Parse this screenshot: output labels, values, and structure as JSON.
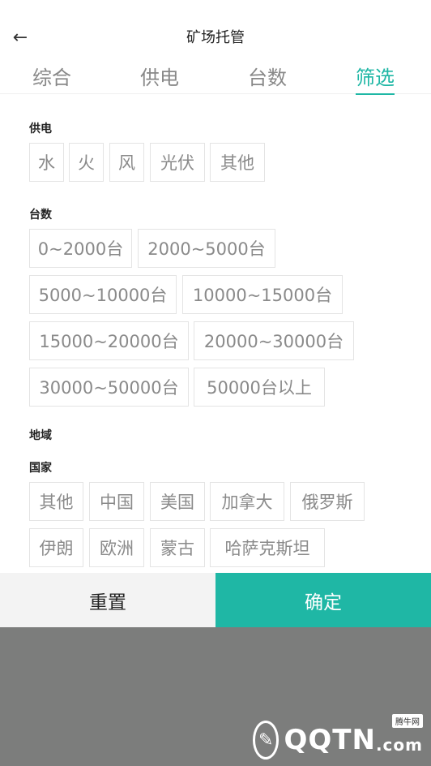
{
  "header": {
    "title": "矿场托管",
    "back_icon": "arrow-left-icon"
  },
  "tabs": [
    {
      "label": "综合"
    },
    {
      "label": "供电"
    },
    {
      "label": "台数"
    },
    {
      "label": "筛选",
      "active": true
    }
  ],
  "filters": {
    "power": {
      "label": "供电",
      "options": [
        "水",
        "火",
        "风",
        "光伏",
        "其他"
      ]
    },
    "count": {
      "label": "台数",
      "options": [
        "0~2000台",
        "2000~5000台",
        "5000~10000台",
        "10000~15000台",
        "15000~20000台",
        "20000~30000台",
        "30000~50000台",
        "50000台以上"
      ]
    },
    "region": {
      "label": "地域"
    },
    "country": {
      "label": "国家",
      "options": [
        "其他",
        "中国",
        "美国",
        "加拿大",
        "俄罗斯",
        "伊朗",
        "欧洲",
        "蒙古",
        "哈萨克斯坦"
      ]
    }
  },
  "actions": {
    "reset_label": "重置",
    "confirm_label": "确定"
  },
  "watermark": {
    "text": "QQTN",
    "suffix": ".com",
    "tag": "腾牛网"
  },
  "colors": {
    "accent": "#1fb7a5",
    "overlay": "#7c7d7c"
  }
}
